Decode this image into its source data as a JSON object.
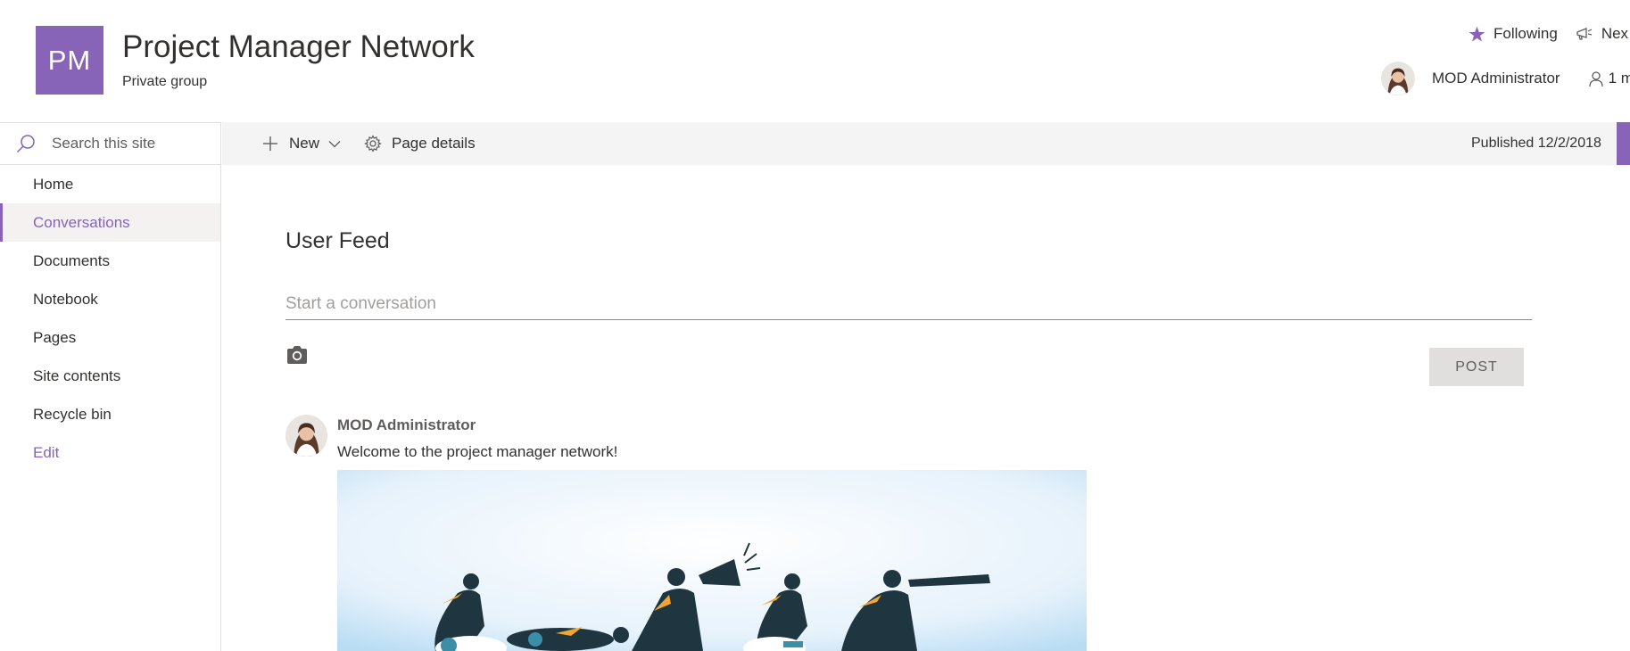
{
  "site": {
    "logo_text": "PM",
    "title": "Project Manager Network",
    "subtitle": "Private group",
    "brand_color": "#8764b8"
  },
  "header": {
    "following_label": "Following",
    "next_label": "Nex",
    "user_name": "MOD Administrator",
    "members_label": "1 m"
  },
  "nav": {
    "search_placeholder": "Search this site",
    "items": [
      {
        "label": "Home"
      },
      {
        "label": "Conversations",
        "active": true
      },
      {
        "label": "Documents"
      },
      {
        "label": "Notebook"
      },
      {
        "label": "Pages"
      },
      {
        "label": "Site contents"
      },
      {
        "label": "Recycle bin"
      },
      {
        "label": "Edit"
      }
    ]
  },
  "command_bar": {
    "new_label": "New",
    "details_label": "Page details",
    "published": "Published 12/2/2018"
  },
  "feed": {
    "title": "User Feed",
    "input_placeholder": "Start a conversation",
    "post_button": "POST",
    "post": {
      "author": "MOD Administrator",
      "text": "Welcome to the project manager network!"
    }
  },
  "icons": {
    "star": "star-icon",
    "megaphone": "megaphone-icon",
    "person": "person-icon",
    "search": "search-icon",
    "plus": "plus-icon",
    "chevron": "chevron-down-icon",
    "gear": "gear-icon",
    "camera": "camera-icon"
  }
}
